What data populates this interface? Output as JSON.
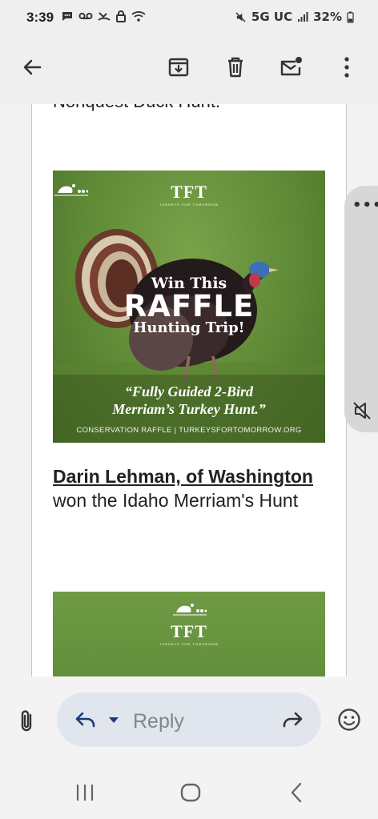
{
  "status_bar": {
    "time": "3:39",
    "left_icons": [
      "chat-icon",
      "voicemail-icon",
      "missed-call-icon",
      "lock-icon",
      "wifi-icon"
    ],
    "network": "5G UC",
    "battery": "32%"
  },
  "toolbar": {
    "icons": [
      "back-arrow-icon",
      "archive-icon",
      "delete-icon",
      "mark-unread-icon",
      "more-options-icon"
    ]
  },
  "email": {
    "cut_text": "Nonquest Duck Hunt.",
    "raffle_image": {
      "logo_text": "TFT",
      "logo_subtext": "TURKEYS FOR TOMORROW",
      "win_this": "Win This",
      "raffle": "RAFFLE",
      "hunting_trip": "Hunting Trip!",
      "quote_line1": "“Fully Guided 2-Bird",
      "quote_line2": "Merriam’s Turkey Hunt.”",
      "footer": "CONSERVATION RAFFLE | TURKEYSFORTOMORROW.ORG"
    },
    "winner": {
      "name_link": "Darin Lehman, of Washington",
      "rest": " won the Idaho Merriam's Hunt"
    },
    "second_image": {
      "logo_text": "TFT",
      "logo_subtext": "TURKEYS FOR TOMORROW"
    }
  },
  "edge_panel": {
    "dots": "•••",
    "icon": "mute-icon"
  },
  "reply_bar": {
    "reply_label": "Reply",
    "icons": [
      "attachment-icon",
      "reply-icon",
      "dropdown-icon",
      "forward-icon",
      "emoji-icon"
    ]
  },
  "nav_bar": {
    "icons": [
      "recents-icon",
      "home-icon",
      "back-icon"
    ]
  },
  "colors": {
    "accent": "#1a73e8",
    "reply_pill": "#e1e6ee",
    "grass": "#5f8a36"
  }
}
